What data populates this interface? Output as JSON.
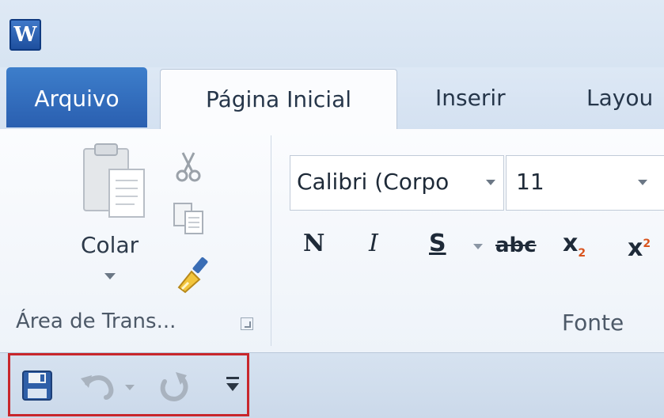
{
  "app": {
    "logo_letter": "W",
    "name": "Microsoft Word"
  },
  "tabs": [
    {
      "label": "Arquivo",
      "active": false,
      "style": "file"
    },
    {
      "label": "Página Inicial",
      "active": true
    },
    {
      "label": "Inserir",
      "active": false
    },
    {
      "label": "Layou",
      "active": false
    }
  ],
  "ribbon": {
    "clipboard": {
      "paste_label": "Colar",
      "group_label": "Área de Trans...",
      "icons": [
        "paste-icon",
        "cut-icon",
        "copy-icon",
        "format-painter-icon"
      ]
    },
    "font": {
      "font_name": "Calibri (Corpo",
      "font_size": "11",
      "bold": "N",
      "italic": "I",
      "underline": "S",
      "strikethrough": "abc",
      "subscript_base": "x",
      "subscript_mark": "2",
      "superscript_base": "x",
      "superscript_mark": "2",
      "group_label": "Fonte"
    }
  },
  "quick_access": {
    "icons": [
      "save-icon",
      "undo-icon",
      "redo-icon",
      "customize-toolbar-icon"
    ],
    "highlight_color": "#c8262c"
  },
  "colors": {
    "file_tab": "#2a5fb0",
    "title_bg": "#dfe9f5",
    "ribbon_bg": "#fbfcfe"
  }
}
